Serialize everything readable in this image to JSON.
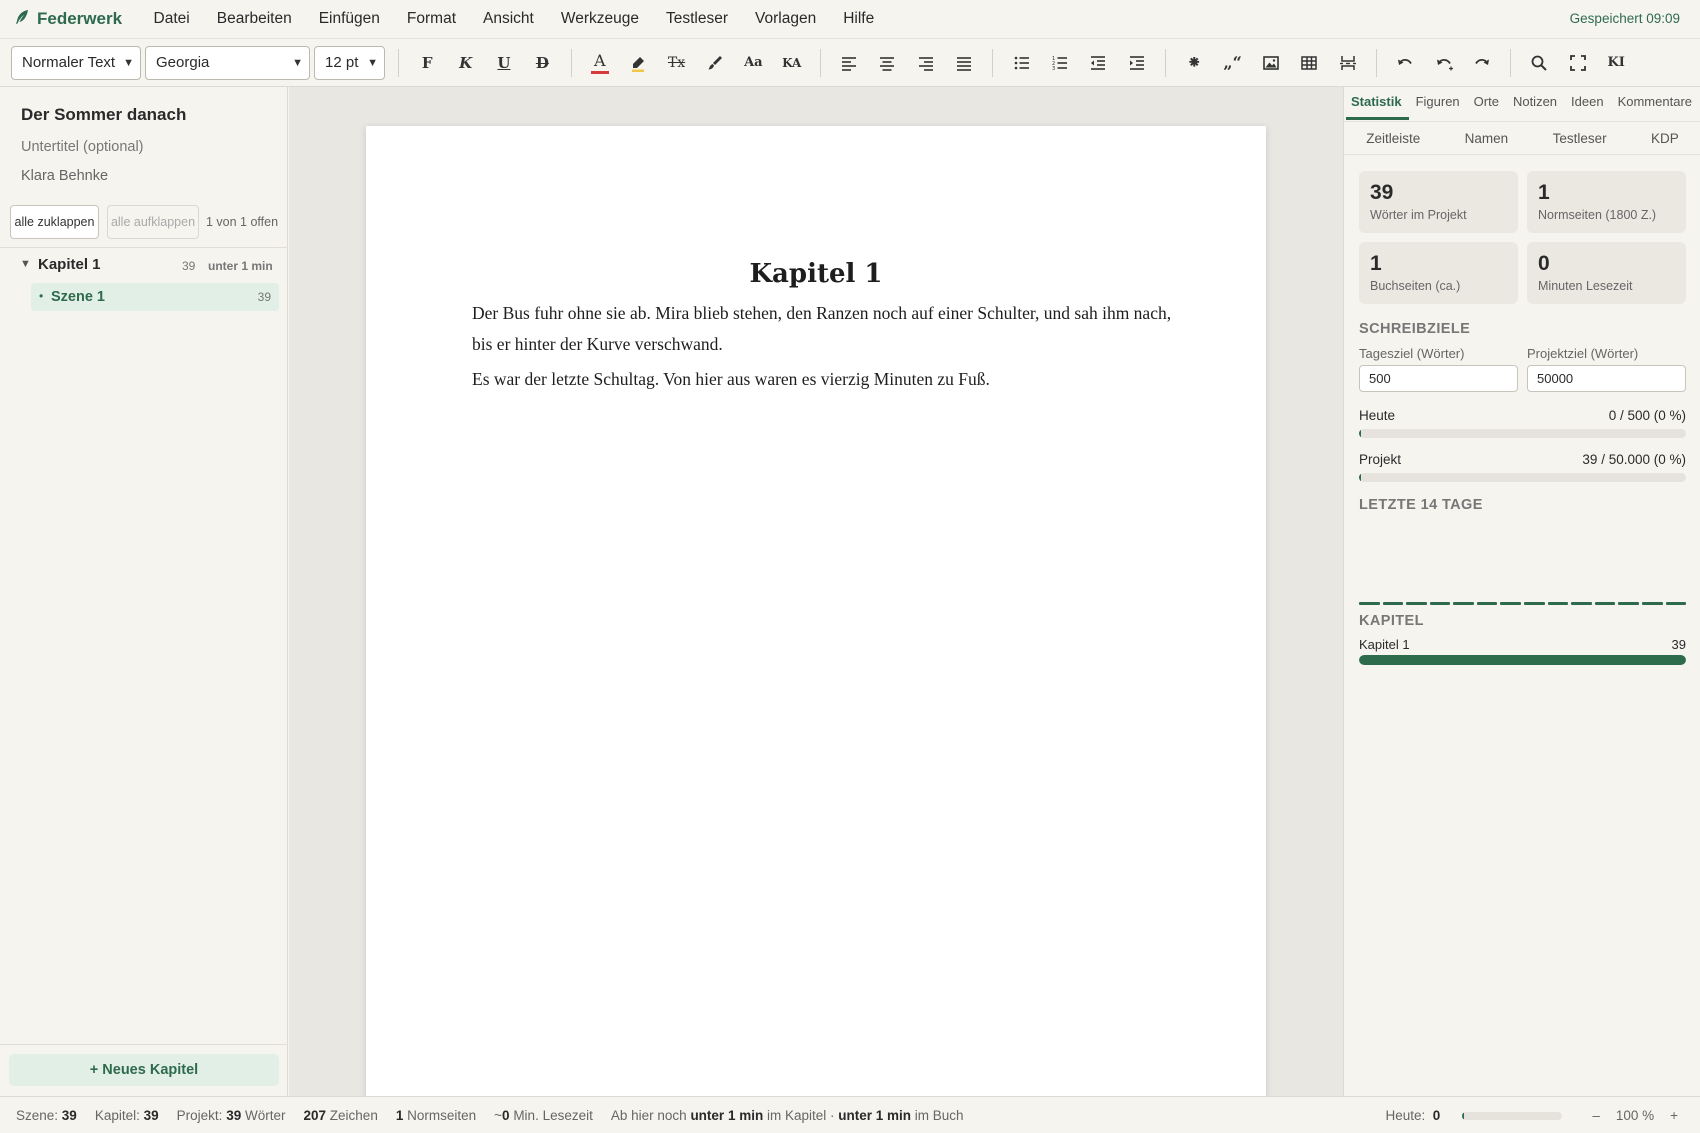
{
  "app": {
    "name": "Federwerk",
    "saved_status": "Gespeichert 09:09"
  },
  "menu": [
    "Datei",
    "Bearbeiten",
    "Einfügen",
    "Format",
    "Ansicht",
    "Werkzeuge",
    "Testleser",
    "Vorlagen",
    "Hilfe"
  ],
  "toolbar": {
    "style_select": "Normaler Text",
    "font_select": "Georgia",
    "size_select": "12 pt",
    "bold_glyph": "F",
    "italic_glyph": "K",
    "underline_glyph": "U",
    "strike_glyph": "D",
    "text_color_glyph": "A",
    "clear_format_glyph": "Tx",
    "case_glyph": "Aa",
    "smallcaps_glyph": "KA",
    "scene_break_glyph": "⁕",
    "quotes_glyph": "„“",
    "ai_glyph": "KI",
    "colors": {
      "text_color": "#d63a3a",
      "highlight": "#f2c744"
    }
  },
  "sidebar": {
    "project_title": "Der Sommer danach",
    "subtitle_placeholder": "Untertitel (optional)",
    "author": "Klara Behnke",
    "collapse_all": "alle zuklappen",
    "expand_all": "alle aufklappen",
    "open_count": "1 von 1 offen",
    "chapters": [
      {
        "name": "Kapitel 1",
        "words": "39",
        "time": "unter 1 min",
        "scenes": [
          {
            "name": "Szene 1",
            "words": "39"
          }
        ]
      }
    ],
    "new_chapter": "+ Neues Kapitel"
  },
  "document": {
    "chapter_title": "Kapitel 1",
    "paragraphs": [
      "Der Bus fuhr ohne sie ab. Mira blieb stehen, den Ranzen noch auf einer Schulter, und sah ihm nach, bis er hinter der Kurve verschwand.",
      "Es war der letzte Schultag. Von hier aus waren es vierzig Minuten zu Fuß."
    ]
  },
  "panel": {
    "tabs": [
      "Statistik",
      "Figuren",
      "Orte",
      "Notizen",
      "Ideen",
      "Kommentare"
    ],
    "subtabs": [
      "Zeitleiste",
      "Namen",
      "Testleser",
      "KDP"
    ],
    "stats": [
      {
        "value": "39",
        "label": "Wörter im Projekt"
      },
      {
        "value": "1",
        "label": "Normseiten (1800 Z.)"
      },
      {
        "value": "1",
        "label": "Buchseiten (ca.)"
      },
      {
        "value": "0",
        "label": "Minuten Lesezeit"
      }
    ],
    "goals_heading": "SCHREIBZIELE",
    "daily_goal_label": "Tagesziel (Wörter)",
    "daily_goal_value": "500",
    "project_goal_label": "Projektziel (Wörter)",
    "project_goal_value": "50000",
    "today_label": "Heute",
    "today_value": "0 / 500 (0 %)",
    "today_fraction": 0.0,
    "project_label": "Projekt",
    "project_value": "39 / 50.000 (0 %)",
    "project_fraction": 0.0008,
    "recent_heading": "LETZTE 14 TAGE",
    "recent_days": [
      0,
      0,
      0,
      0,
      0,
      0,
      0,
      0,
      0,
      0,
      0,
      0,
      0,
      0
    ],
    "chapters_heading": "KAPITEL",
    "chapter_bars": [
      {
        "name": "Kapitel 1",
        "words": "39",
        "fraction": 1.0
      }
    ],
    "accent": "#2e6b4d"
  },
  "statusbar": {
    "scene_label": "Szene:",
    "scene_value": "39",
    "chapter_label": "Kapitel:",
    "chapter_value": "39",
    "project_label": "Projekt:",
    "project_value": "39",
    "project_unit": "Wörter",
    "chars_value": "207",
    "chars_unit": "Zeichen",
    "norm_value": "1",
    "norm_unit": "Normseiten",
    "read_prefix": "~",
    "read_value": "0",
    "read_unit": "Min. Lesezeit",
    "remain_prefix": "Ab hier noch",
    "remain_ch_value": "unter 1 min",
    "remain_ch_unit": "im Kapitel ·",
    "remain_book_value": "unter 1 min",
    "remain_book_unit": "im Buch",
    "today_label": "Heute:",
    "today_value": "0",
    "zoom_minus": "–",
    "zoom_value": "100 %",
    "zoom_plus": "+"
  }
}
